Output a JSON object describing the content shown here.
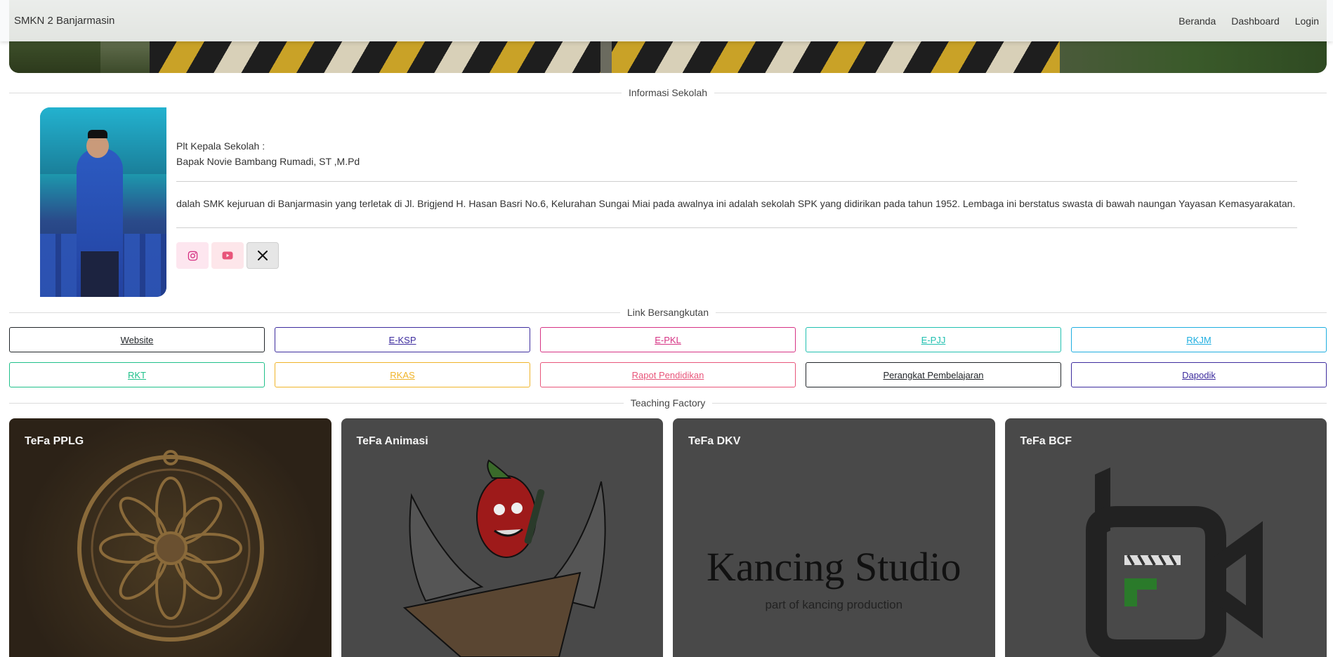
{
  "navbar": {
    "brand": "SMKN 2 Banjarmasin",
    "links": [
      "Beranda",
      "Dashboard",
      "Login"
    ]
  },
  "sections": {
    "info": "Informasi Sekolah",
    "links": "Link Bersangkutan",
    "tefa": "Teaching Factory"
  },
  "info": {
    "role": "Plt Kepala Sekolah :",
    "name": "Bapak Novie Bambang Rumadi, ST ,M.Pd",
    "description": "dalah SMK kejuruan di Banjarmasin yang terletak di Jl. Brigjend H. Hasan Basri No.6, Kelurahan Sungai Miai pada awalnya ini adalah sekolah SPK yang didirikan pada tahun 1952. Lembaga ini berstatus swasta di bawah naungan Yayasan Kemasyarakatan."
  },
  "social": [
    {
      "icon": "instagram-icon",
      "color": "#d63384"
    },
    {
      "icon": "youtube-icon",
      "color": "#e8557a"
    },
    {
      "icon": "x-twitter-icon",
      "color": "#111111"
    }
  ],
  "link_buttons": [
    {
      "label": "Website",
      "color": "#212529"
    },
    {
      "label": "E-KSP",
      "color": "#3d2c9e"
    },
    {
      "label": "E-PKL",
      "color": "#d63384"
    },
    {
      "label": "E-PJJ",
      "color": "#20c0b0"
    },
    {
      "label": "RKJM",
      "color": "#1eaee0"
    },
    {
      "label": "RKT",
      "color": "#20c08a"
    },
    {
      "label": "RKAS",
      "color": "#f0b429"
    },
    {
      "label": "Rapot Pendidikan",
      "color": "#e8557a"
    },
    {
      "label": "Perangkat Pembelajaran",
      "color": "#212529"
    },
    {
      "label": "Dapodik",
      "color": "#3d2c9e"
    }
  ],
  "tefa_cards": [
    {
      "title": "TeFa PPLG"
    },
    {
      "title": "TeFa Animasi"
    },
    {
      "title": "TeFa DKV",
      "logo_text": "Kancing Studio",
      "logo_sub": "part of kancing production"
    },
    {
      "title": "TeFa BCF"
    }
  ]
}
